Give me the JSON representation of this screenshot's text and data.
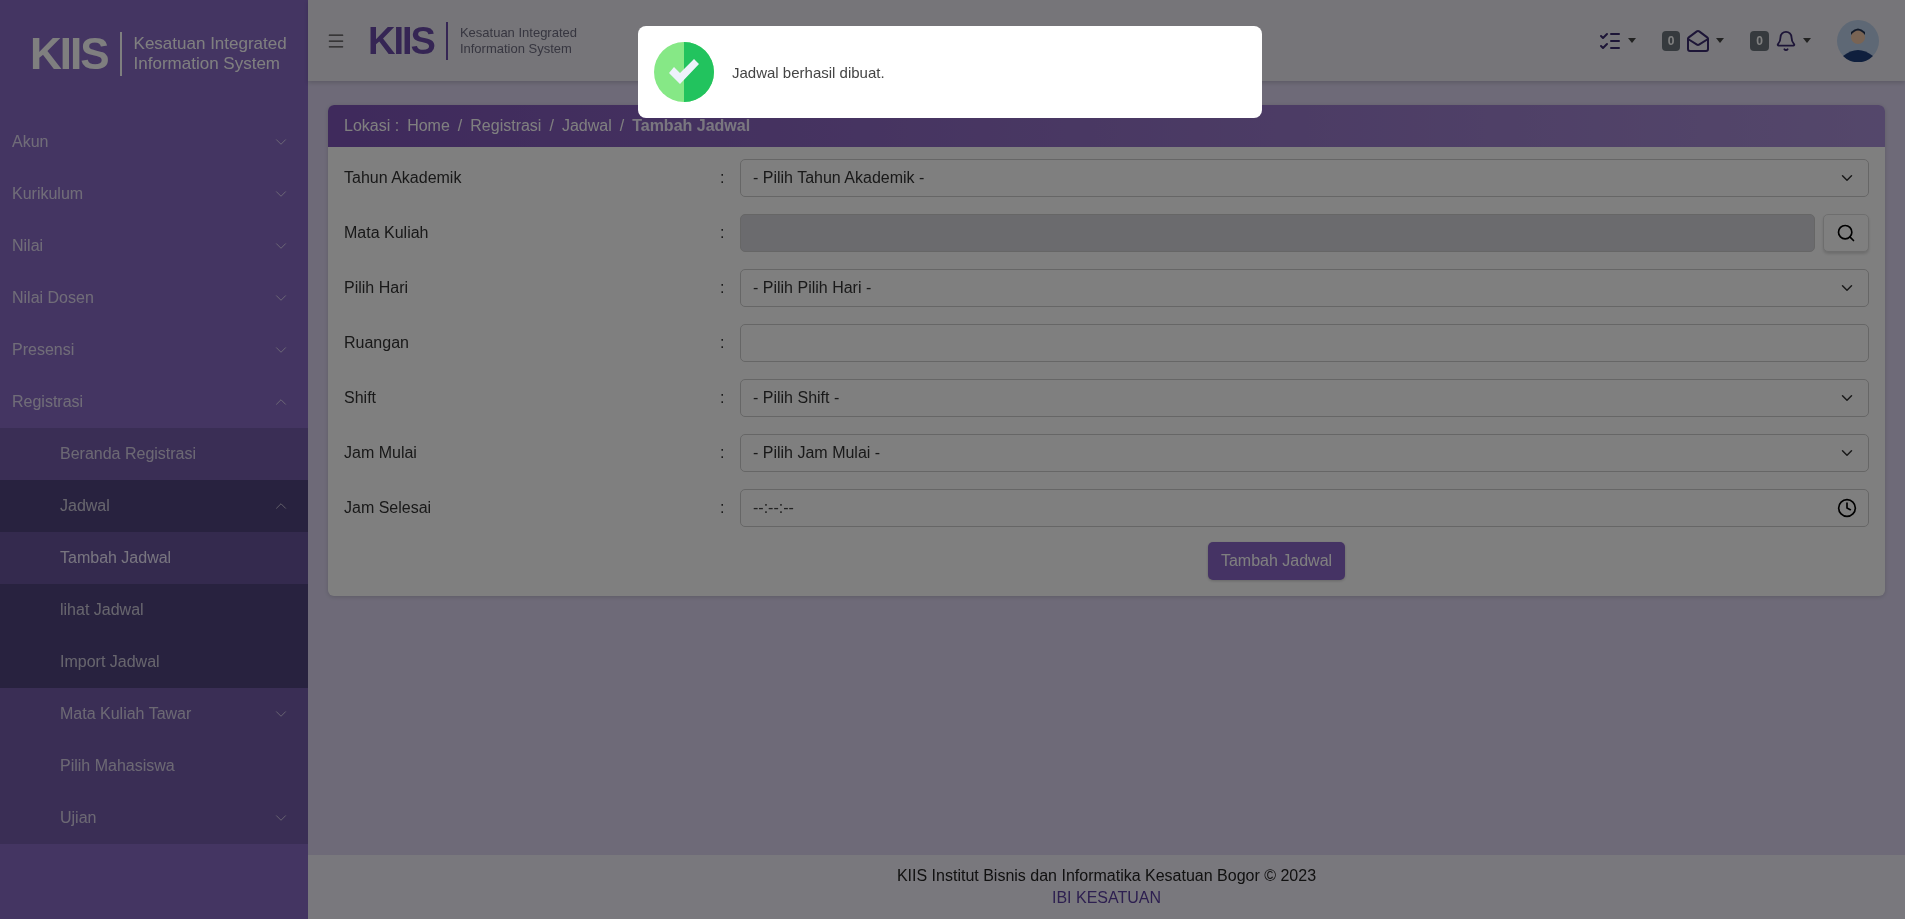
{
  "sidebar": {
    "logo": {
      "mark": "KIIS",
      "text": "Kesatuan Integrated\nInformation System"
    },
    "items": [
      {
        "label": "Akun",
        "expanded": false
      },
      {
        "label": "Kurikulum",
        "expanded": false
      },
      {
        "label": "Nilai",
        "expanded": false
      },
      {
        "label": "Nilai Dosen",
        "expanded": false
      },
      {
        "label": "Presensi",
        "expanded": false
      },
      {
        "label": "Registrasi",
        "expanded": true,
        "children": [
          {
            "label": "Beranda Registrasi",
            "selected": false
          },
          {
            "label": "Jadwal",
            "expanded": true,
            "children": [
              {
                "label": "Tambah Jadwal",
                "selected": true
              },
              {
                "label": "lihat Jadwal",
                "selected": false
              },
              {
                "label": "Import Jadwal",
                "selected": false
              }
            ]
          },
          {
            "label": "Mata Kuliah Tawar",
            "expanded": false
          },
          {
            "label": "Pilih Mahasiswa",
            "selected": false
          },
          {
            "label": "Ujian",
            "expanded": false
          }
        ]
      }
    ]
  },
  "header": {
    "logo": {
      "mark": "KIIS",
      "text": "Kesatuan Integrated\nInformation System"
    },
    "messages_count": "0",
    "notifications_count": "0"
  },
  "breadcrumb": {
    "label": "Lokasi :",
    "separator": "/",
    "items": [
      "Home",
      "Registrasi",
      "Jadwal",
      "Tambah Jadwal"
    ]
  },
  "form": {
    "rows": [
      {
        "kind": "select",
        "label": "Tahun Akademik",
        "colon": ":",
        "value": "- Pilih Tahun Akademik -"
      },
      {
        "kind": "search",
        "label": "Mata Kuliah",
        "colon": ":",
        "disabled": true
      },
      {
        "kind": "select",
        "label": "Pilih Hari",
        "colon": ":",
        "value": "- Pilih Pilih Hari -"
      },
      {
        "kind": "text",
        "label": "Ruangan",
        "colon": ":"
      },
      {
        "kind": "select",
        "label": "Shift",
        "colon": ":",
        "value": "- Pilih Shift -"
      },
      {
        "kind": "select",
        "label": "Jam Mulai",
        "colon": ":",
        "value": "- Pilih Jam Mulai -"
      },
      {
        "kind": "time",
        "label": "Jam Selesai",
        "colon": ":",
        "placeholder": "--:--:--"
      }
    ],
    "submit": "Tambah Jadwal"
  },
  "footer": {
    "copyright": "KIIS Institut Bisnis dan Informatika Kesatuan Bogor © 2023",
    "link": "IBI KESATUAN"
  },
  "toast": {
    "kind": "success",
    "message": "Jadwal berhasil dibuat."
  }
}
